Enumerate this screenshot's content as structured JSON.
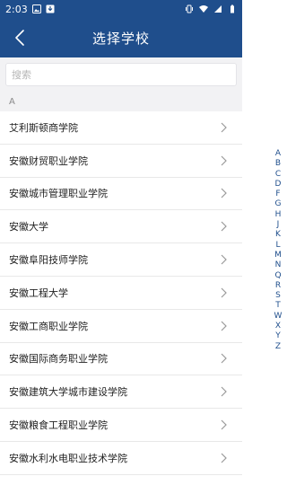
{
  "status": {
    "time": "2:03"
  },
  "header": {
    "title": "选择学校"
  },
  "search": {
    "placeholder": "搜索"
  },
  "section": {
    "letter": "A"
  },
  "schools": [
    "艾利斯顿商学院",
    "安徽财贸职业学院",
    "安徽城市管理职业学院",
    "安徽大学",
    "安徽阜阳技师学院",
    "安徽工程大学",
    "安徽工商职业学院",
    "安徽国际商务职业学院",
    "安徽建筑大学城市建设学院",
    "安徽粮食工程职业学院",
    "安徽水利水电职业技术学院"
  ],
  "index_letters": [
    "A",
    "B",
    "C",
    "D",
    "F",
    "G",
    "H",
    "J",
    "K",
    "L",
    "M",
    "N",
    "Q",
    "R",
    "S",
    "T",
    "W",
    "X",
    "Y",
    "Z"
  ],
  "colors": {
    "primary": "#1f4e8c",
    "section_bg": "#f2f2f4"
  }
}
